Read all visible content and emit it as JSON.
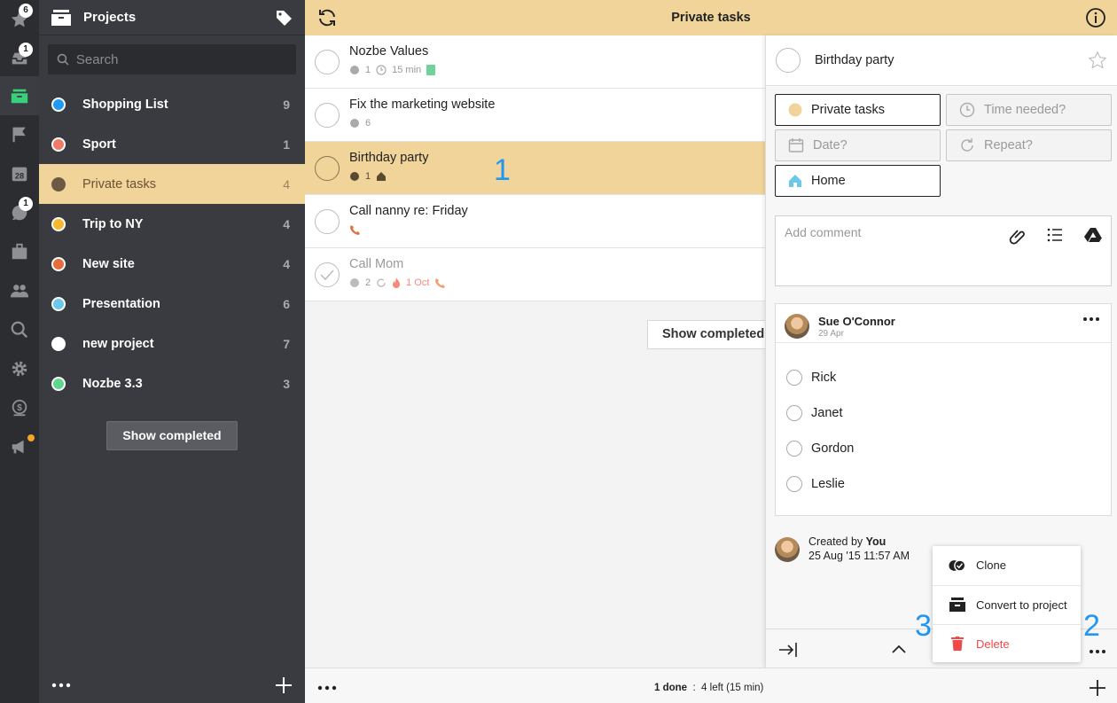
{
  "rail": {
    "badges": {
      "starred": "6",
      "inbox": "1",
      "comments": "1"
    }
  },
  "sidebar": {
    "title": "Projects",
    "search_placeholder": "Search",
    "projects": [
      {
        "name": "Shopping List",
        "count": "9",
        "color": "#1e9bf0"
      },
      {
        "name": "Sport",
        "count": "1",
        "color": "#f07a6a"
      },
      {
        "name": "Private tasks",
        "count": "4",
        "color": "#6b5a45"
      },
      {
        "name": "Trip to NY",
        "count": "4",
        "color": "#f5b82e"
      },
      {
        "name": "New site",
        "count": "4",
        "color": "#e56d3c"
      },
      {
        "name": "Presentation",
        "count": "6",
        "color": "#6cc7e8"
      },
      {
        "name": "new project",
        "count": "7",
        "color": "#ffffff"
      },
      {
        "name": "Nozbe 3.3",
        "count": "3",
        "color": "#5fd68c"
      }
    ],
    "show_completed": "Show completed"
  },
  "topbar": {
    "title": "Private tasks"
  },
  "tasks": [
    {
      "name": "Nozbe Values",
      "comments": "1",
      "time": "15 min"
    },
    {
      "name": "Fix the marketing website",
      "comments": "6"
    },
    {
      "name": "Birthday party",
      "comments": "1"
    },
    {
      "name": "Call nanny re: Friday"
    },
    {
      "name": "Call Mom",
      "comments": "2",
      "date": "1 Oct"
    }
  ],
  "main": {
    "show_completed": "Show completed"
  },
  "labels": {
    "one": "1",
    "two": "2",
    "three": "3"
  },
  "detail": {
    "title": "Birthday party",
    "project": "Private tasks",
    "time_needed": "Time needed?",
    "date": "Date?",
    "repeat": "Repeat?",
    "context": "Home",
    "comment_placeholder": "Add comment",
    "comment": {
      "author": "Sue O'Connor",
      "date": "29 Apr",
      "items": [
        "Rick",
        "Janet",
        "Gordon",
        "Leslie"
      ]
    },
    "created_by_prefix": "Created by",
    "created_by": "You",
    "created_at": "25 Aug '15 11:57 AM"
  },
  "menu": {
    "clone": "Clone",
    "convert": "Convert to project",
    "delete": "Delete"
  },
  "status": {
    "done": "1 done",
    "sep": ":",
    "left": "4 left (15 min)"
  },
  "colors": {
    "accent": "#f0d49a",
    "label": "#2196f3",
    "danger": "#f04848"
  }
}
